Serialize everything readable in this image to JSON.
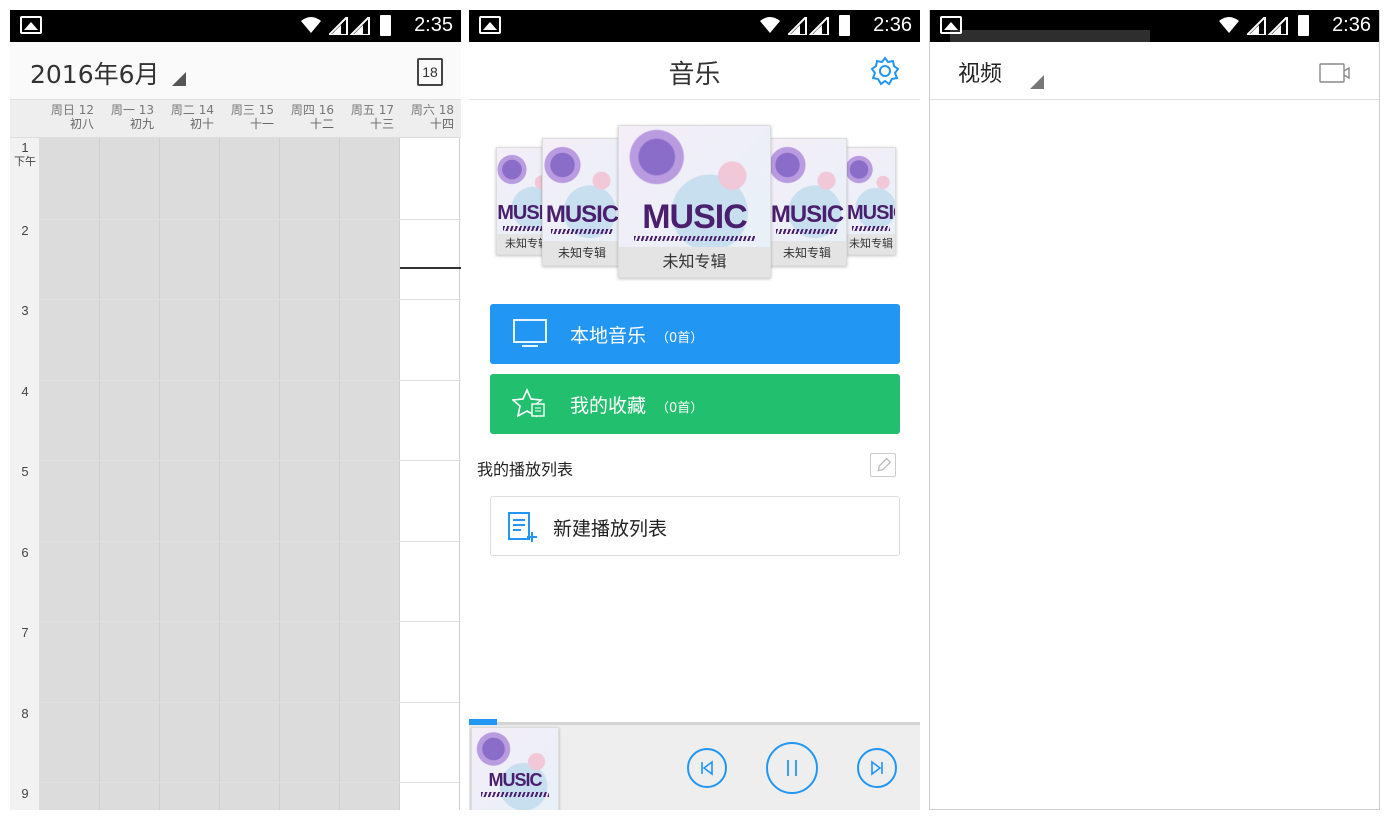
{
  "status_bars": [
    {
      "time": "2:35"
    },
    {
      "time": "2:36"
    },
    {
      "time": "2:36"
    }
  ],
  "calendar": {
    "title": "2016年6月",
    "today_icon_label": "18",
    "days": [
      {
        "weekday": "周日",
        "date": "12",
        "lunar": "初八"
      },
      {
        "weekday": "周一",
        "date": "13",
        "lunar": "初九"
      },
      {
        "weekday": "周二",
        "date": "14",
        "lunar": "初十"
      },
      {
        "weekday": "周三",
        "date": "15",
        "lunar": "十一"
      },
      {
        "weekday": "周四",
        "date": "16",
        "lunar": "十二"
      },
      {
        "weekday": "周五",
        "date": "17",
        "lunar": "十三"
      },
      {
        "weekday": "周六",
        "date": "18",
        "lunar": "十四"
      }
    ],
    "hours": [
      "1",
      "2",
      "3",
      "4",
      "5",
      "6",
      "7",
      "8",
      "9"
    ],
    "afternoon_label": "下午"
  },
  "music": {
    "title": "音乐",
    "settings_icon": "gear-icon",
    "album_caption": "未知专辑",
    "cover_word": "MUSIC",
    "local_music": {
      "label": "本地音乐",
      "count": "（0首）",
      "icon": "monitor-icon"
    },
    "favorites": {
      "label": "我的收藏",
      "count": "（0首）",
      "icon": "star-list-icon"
    },
    "playlist_section": "我的播放列表",
    "new_playlist": "新建播放列表",
    "accent": "#2196f3",
    "green": "#22c06e"
  },
  "video": {
    "title": "视频",
    "camera_icon": "video-camera-icon"
  }
}
